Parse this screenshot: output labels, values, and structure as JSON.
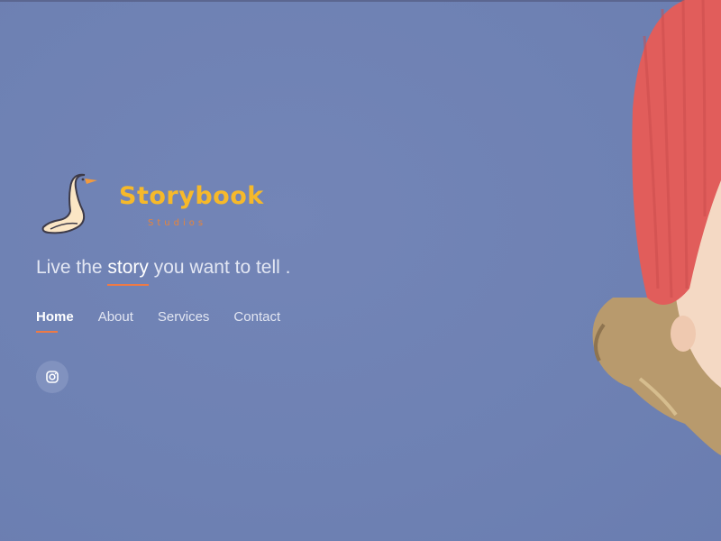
{
  "brand": {
    "name": "Storybook",
    "subtitle": "Studios"
  },
  "tagline": {
    "before": "Live the ",
    "highlight": "story",
    "after": " you want to tell ."
  },
  "nav": {
    "items": [
      {
        "label": "Home",
        "active": true
      },
      {
        "label": "About",
        "active": false
      },
      {
        "label": "Services",
        "active": false
      },
      {
        "label": "Contact",
        "active": false
      }
    ]
  },
  "social": {
    "icon": "instagram-icon"
  },
  "colors": {
    "background": "#6f82b4",
    "brand_yellow": "#f6b92a",
    "accent_orange": "#ee7a45",
    "hat_red": "#e0595a"
  }
}
